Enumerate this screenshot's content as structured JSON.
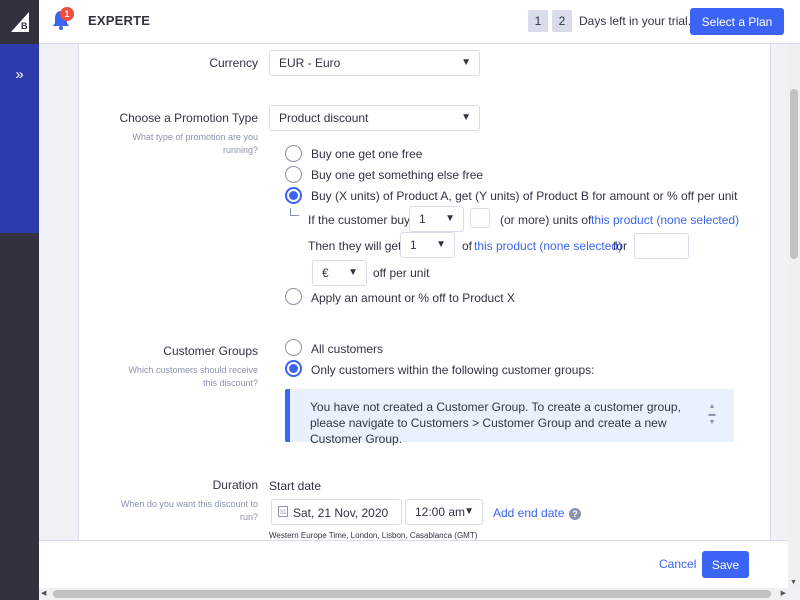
{
  "header": {
    "store_name": "EXPERTE",
    "notification_count": "1",
    "trial_digit_1": "1",
    "trial_digit_2": "2",
    "trial_text": "Days left in your trial.",
    "select_plan_label": "Select a Plan"
  },
  "sidebar": {
    "expand_glyph": "»"
  },
  "form": {
    "currency": {
      "label": "Currency",
      "value": "EUR - Euro"
    },
    "promotion_type": {
      "label": "Choose a Promotion Type",
      "help": "What type of promotion are you running?",
      "value": "Product discount",
      "options": [
        {
          "label": "Buy one get one free",
          "selected": false
        },
        {
          "label": "Buy one get something else free",
          "selected": false
        },
        {
          "label": "Buy (X units) of Product A, get (Y units) of Product B for amount or % off per unit",
          "selected": true
        },
        {
          "label": "Apply an amount or % off to Product X",
          "selected": false
        }
      ],
      "detail": {
        "if_buys_label": "If the customer buys",
        "buy_qty": "1",
        "or_more_text": "(or more) units of",
        "product_a_link": "this product (none selected)",
        "then_get_label": "Then they will get",
        "get_qty": "1",
        "of_text": "of",
        "product_b_link": "this product (none selected)",
        "for_text": "for",
        "currency_symbol": "€",
        "off_per_unit": "off per unit"
      }
    },
    "customer_groups": {
      "label": "Customer Groups",
      "help": "Which customers should receive this discount?",
      "options": [
        {
          "label": "All customers",
          "selected": false
        },
        {
          "label": "Only customers within the following customer groups:",
          "selected": true
        }
      ],
      "info": "You have not created a Customer Group. To create a customer group, please navigate to Customers > Customer Group and create a new Customer Group."
    },
    "duration": {
      "label": "Duration",
      "help": "When do you want this discount to run?",
      "start_label": "Start date",
      "start_date": "Sat, 21 Nov, 2020",
      "start_time": "12:00 am",
      "add_end_date": "Add end date",
      "timezone": "Western Europe Time, London, Lisbon, Casablanca (GMT)",
      "calendar_day": "31"
    }
  },
  "footer": {
    "cancel_label": "Cancel",
    "save_label": "Save"
  },
  "colors": {
    "accent": "#3c64f4",
    "sidebar_blue": "#2d3caa",
    "sidebar_dark": "#34313f",
    "info_bg": "#e9f1fd"
  }
}
